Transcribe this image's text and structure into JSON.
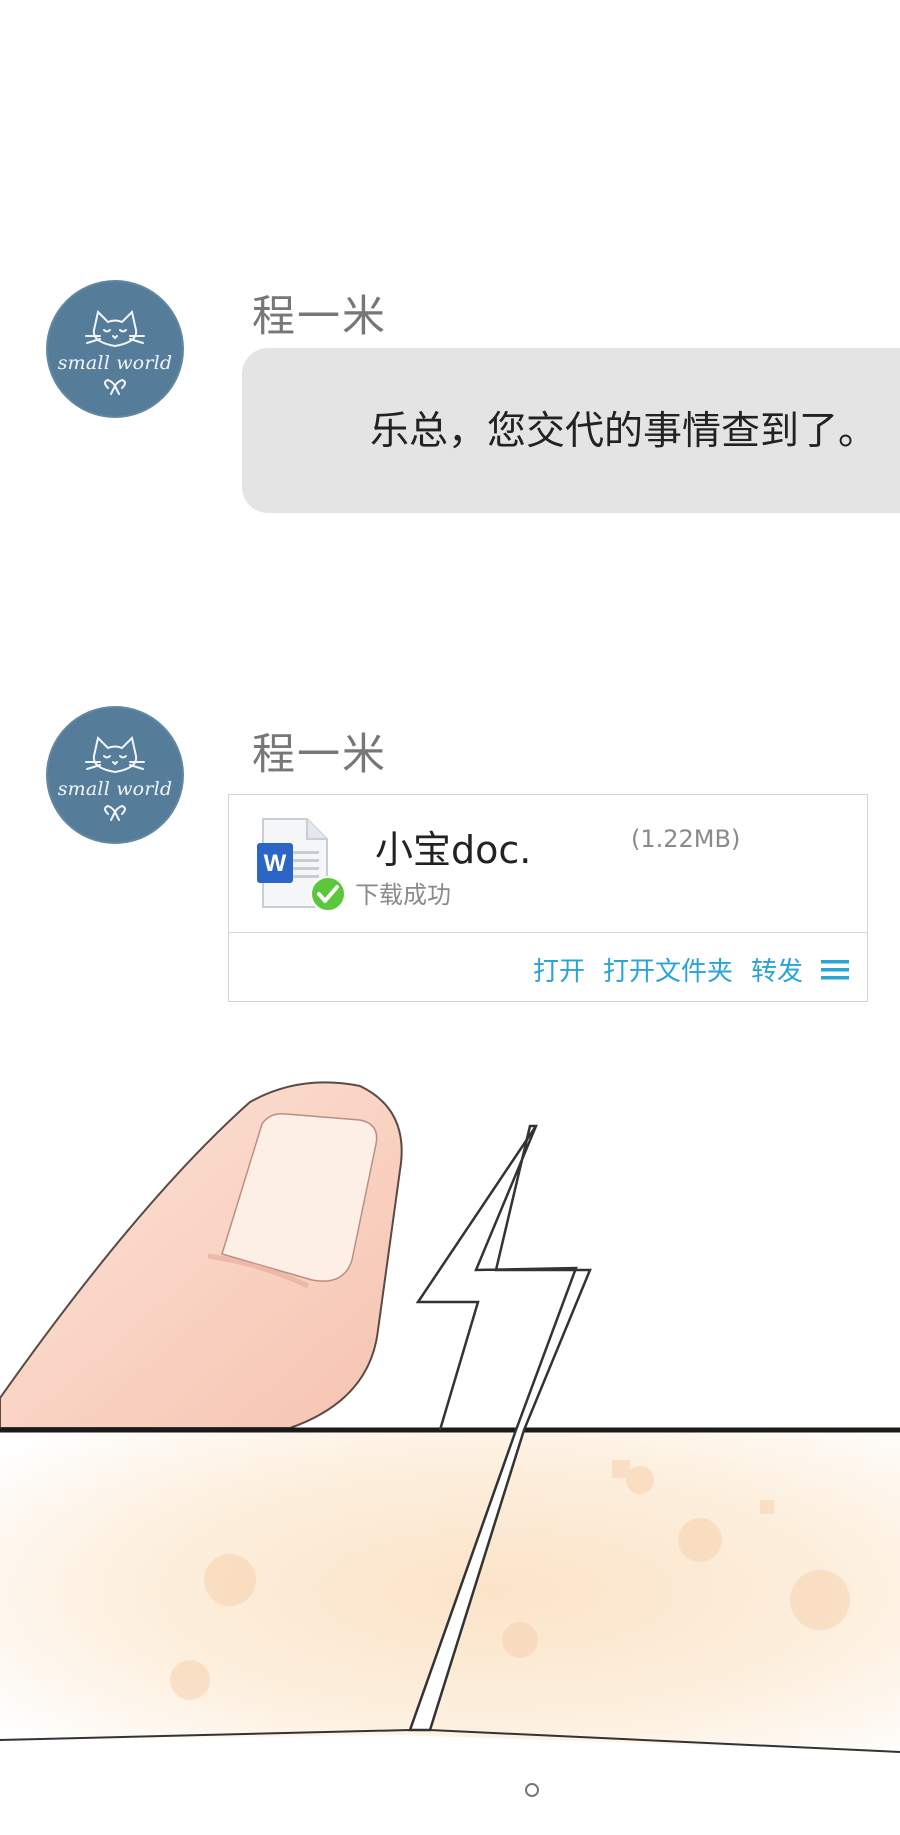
{
  "messages": [
    {
      "sender": "程一米",
      "avatar_text": "small world",
      "text": "乐总，您交代的事情查到了。"
    },
    {
      "sender": "程一米",
      "avatar_text": "small world",
      "file": {
        "name": "小宝doc.",
        "size": "(1.22MB)",
        "status": "下载成功",
        "actions": [
          "打开",
          "打开文件夹",
          "转发"
        ],
        "icon": "word-doc-icon"
      }
    }
  ],
  "colors": {
    "avatar_bg": "#557d9a",
    "bubble_bg": "#e4e4e4",
    "action_link": "#2aa4d6",
    "success_green": "#5cc63c",
    "word_blue": "#2b66c6"
  }
}
